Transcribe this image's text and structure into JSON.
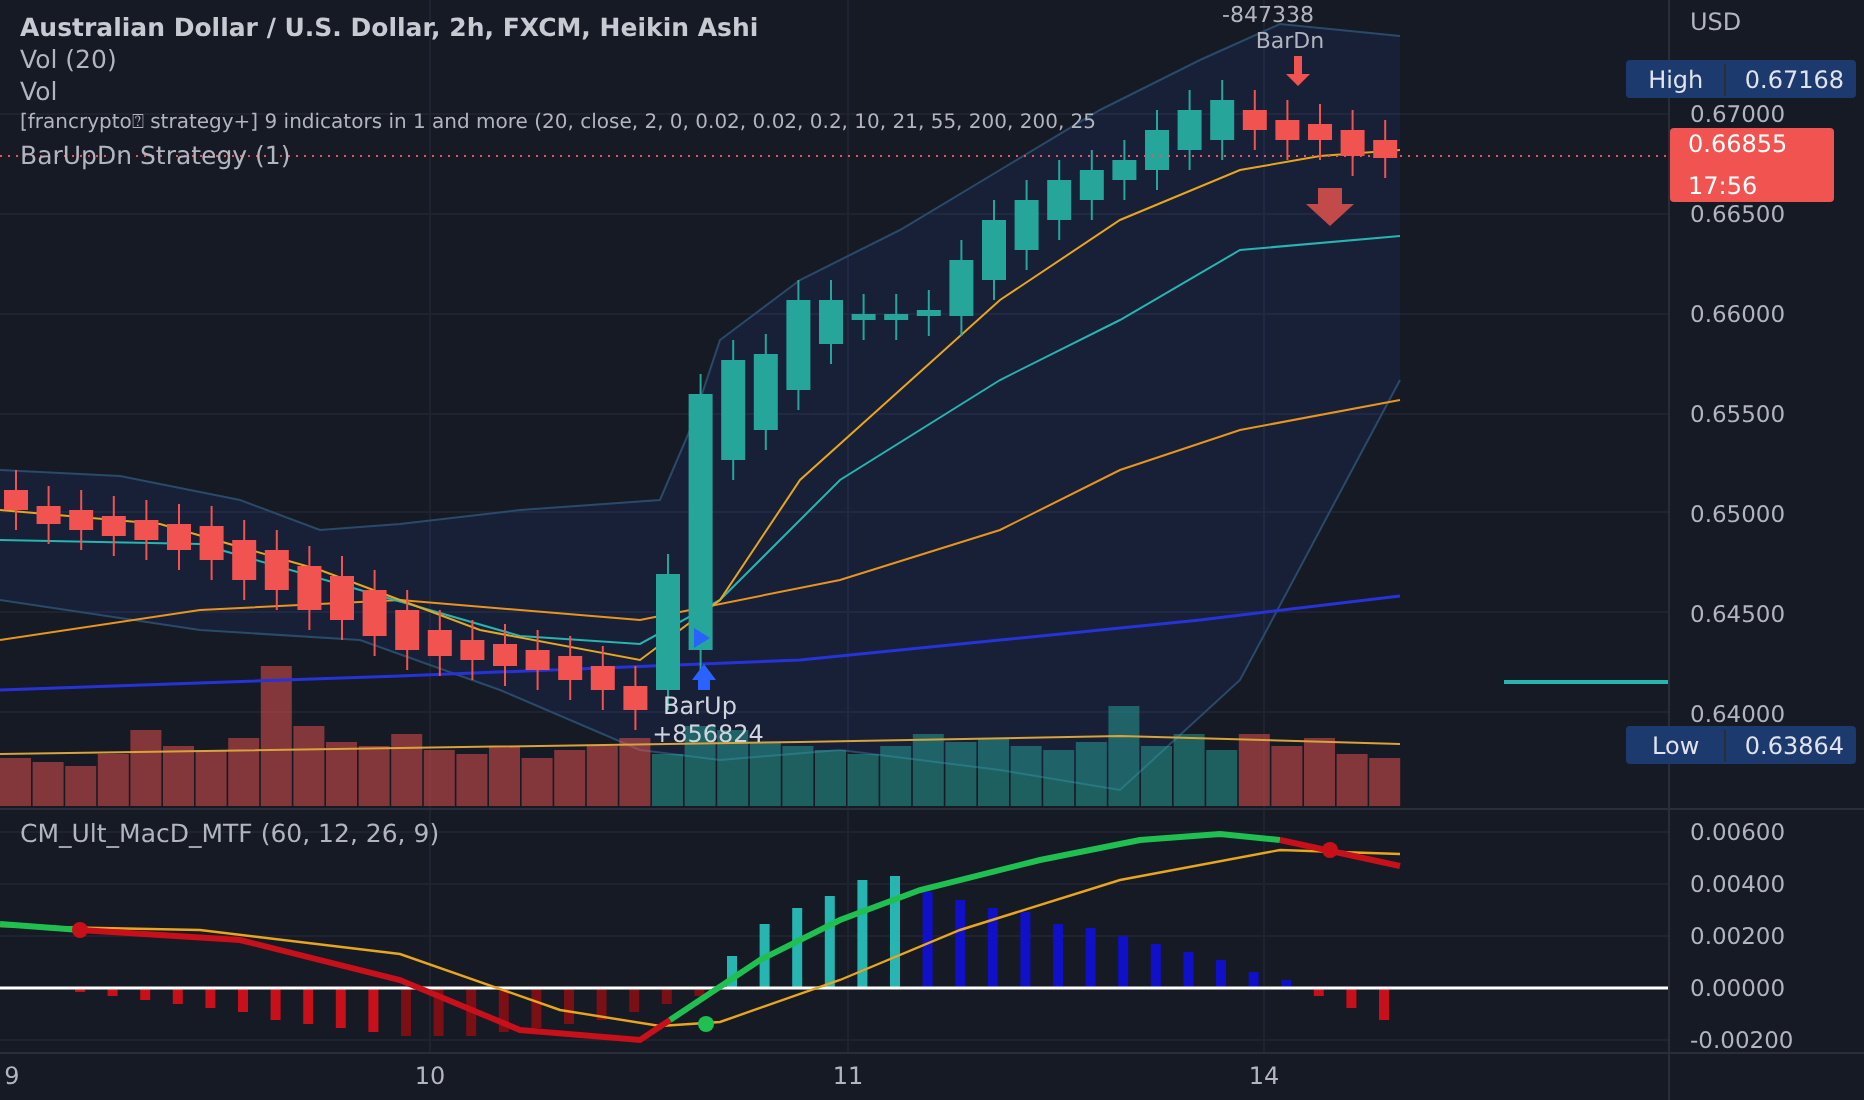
{
  "legend": {
    "title": "Australian Dollar / U.S. Dollar, 2h, FXCM, Heikin Ashi",
    "studies": [
      "Vol (20)",
      "Vol",
      "[francrypto⍰ strategy+] 9 indicators in 1 and more (20, close, 2, 0, 0.02, 0.02, 0.2, 10, 21, 55, 200, 200, 25",
      "BarUpDn Strategy (1)"
    ]
  },
  "signals": [
    {
      "kind": "sell",
      "label": "BarDn",
      "amount": "-847338"
    },
    {
      "kind": "buy",
      "label": "BarUp",
      "amount": "+856824"
    }
  ],
  "price_axis": {
    "currency": "USD",
    "ticks": [
      "0.67000",
      "0.66500",
      "0.66000",
      "0.65500",
      "0.65000",
      "0.64500",
      "0.64000"
    ],
    "high": {
      "label": "High",
      "value": "0.67168"
    },
    "low": {
      "label": "Low",
      "value": "0.63864"
    },
    "last_price": {
      "value": "0.66855",
      "countdown": "17:56"
    }
  },
  "macd": {
    "title": "CM_Ult_MacD_MTF (60, 12, 26, 9)",
    "ticks": [
      "0.00600",
      "0.00400",
      "0.00200",
      "0.00000",
      "-0.00200"
    ]
  },
  "time_axis": [
    "9",
    "10",
    "11",
    "14"
  ]
}
